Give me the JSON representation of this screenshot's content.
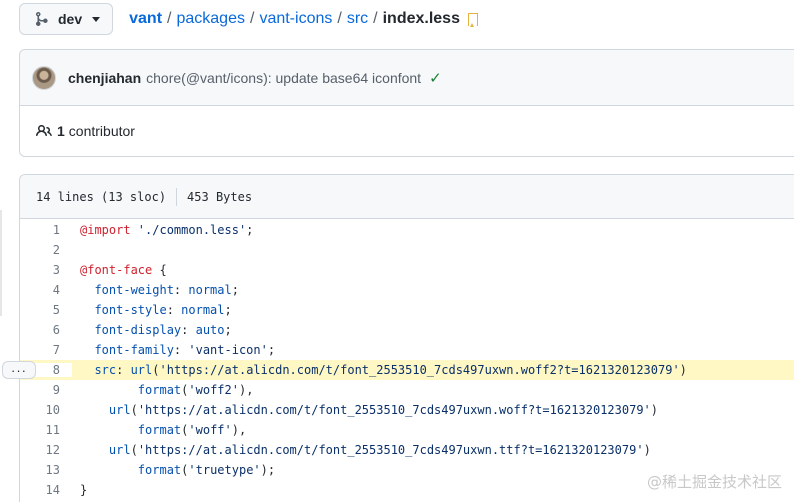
{
  "branch": {
    "label": "dev"
  },
  "breadcrumb": {
    "root": "vant",
    "parts": [
      "packages",
      "vant-icons",
      "src"
    ],
    "file": "index.less",
    "separator": "/"
  },
  "commit": {
    "author": "chenjiahan",
    "message": "chore(@vant/icons): update base64 iconfont",
    "status_glyph": "✓"
  },
  "contributors": {
    "count": "1",
    "label": "contributor"
  },
  "file_info": {
    "lines": "14 lines (13 sloc)",
    "size": "453 Bytes"
  },
  "code": {
    "highlighted_line": 8,
    "lines": [
      {
        "n": "1"
      },
      {
        "n": "2"
      },
      {
        "n": "3"
      },
      {
        "n": "4"
      },
      {
        "n": "5"
      },
      {
        "n": "6"
      },
      {
        "n": "7"
      },
      {
        "n": "8"
      },
      {
        "n": "9"
      },
      {
        "n": "10"
      },
      {
        "n": "11"
      },
      {
        "n": "12"
      },
      {
        "n": "13"
      },
      {
        "n": "14"
      }
    ],
    "tokens": {
      "l1_kw": "@import",
      "l1_str": " './common.less'",
      "l1_end": ";",
      "l3_kw": "@font-face",
      "l3_end": " {",
      "l4_prop": "  font-weight",
      "l4_val": "normal",
      "l5_prop": "  font-style",
      "l5_val": "normal",
      "l6_prop": "  font-display",
      "l6_val": "auto",
      "l7_prop": "  font-family",
      "l7_str": "'vant-icon'",
      "l8_prop": "  src",
      "l8_fn": "url",
      "l8_str": "'https://at.alicdn.com/t/font_2553510_7cds497uxwn.woff2?t=1621320123079'",
      "l9_fn": "format",
      "l9_str": "'woff2'",
      "l10_fn": "url",
      "l10_str": "'https://at.alicdn.com/t/font_2553510_7cds497uxwn.woff?t=1621320123079'",
      "l11_fn": "format",
      "l11_str": "'woff'",
      "l12_fn": "url",
      "l12_str": "'https://at.alicdn.com/t/font_2553510_7cds497uxwn.ttf?t=1621320123079'",
      "l13_fn": "format",
      "l13_str": "'truetype'",
      "l14_end": "}"
    }
  },
  "expand_button": {
    "label": "···"
  },
  "watermark": "@稀土掘金技术社区",
  "colors": {
    "link": "#0969da",
    "highlight": "#fff8c5",
    "keyword": "#cf222e",
    "property": "#0550ae",
    "string": "#0a3069"
  }
}
